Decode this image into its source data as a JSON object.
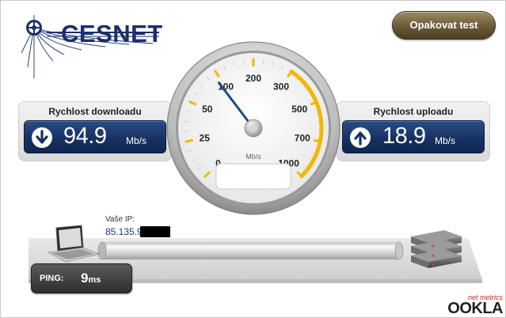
{
  "header": {
    "logo_text": "CESNET",
    "repeat_button_label": "Opakovat test"
  },
  "download": {
    "title": "Rychlost downloadu",
    "value": "94.9",
    "unit": "Mb/s",
    "icon": "arrow-down-icon"
  },
  "upload": {
    "title": "Rychlost uploadu",
    "value": "18.9",
    "unit": "Mb/s",
    "icon": "arrow-up-icon"
  },
  "gauge": {
    "scale_labels": [
      "0",
      "25",
      "50",
      "100",
      "200",
      "300",
      "500",
      "700",
      "1000"
    ],
    "unit": "Mb/s",
    "needle_value_mbps": 94.9,
    "accent_color": "#f2b705"
  },
  "ip": {
    "label": "Vaše IP:",
    "value": "85.135.9"
  },
  "ping": {
    "label": "PING:",
    "value": "9",
    "unit": "ms"
  },
  "branding": {
    "tagline": "net metrics",
    "name": "OOKLA"
  },
  "colors": {
    "brand_navy": "#1a2f6b",
    "readout_blue": "#16305f",
    "button_brown": "#6a5a37",
    "ookla_red": "#d0241c"
  }
}
